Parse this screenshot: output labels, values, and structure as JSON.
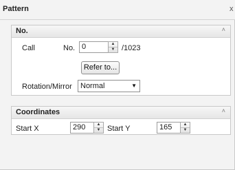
{
  "panel": {
    "title": "Pattern",
    "close_glyph": "x"
  },
  "no_section": {
    "title": "No.",
    "collapse_glyph": "˄",
    "call_label": "Call",
    "no_label": "No.",
    "no_value": "0",
    "no_total": "/1023",
    "refer_button": "Refer to...",
    "rotation_label": "Rotation/Mirror",
    "rotation_selected": "Normal"
  },
  "coordinates_section": {
    "title": "Coordinates",
    "collapse_glyph": "˄",
    "start_x_label": "Start X",
    "start_x_value": "290",
    "start_y_label": "Start Y",
    "start_y_value": "165"
  },
  "icons": {
    "spin_up": "▲",
    "spin_down": "▼",
    "dropdown": "▼"
  }
}
